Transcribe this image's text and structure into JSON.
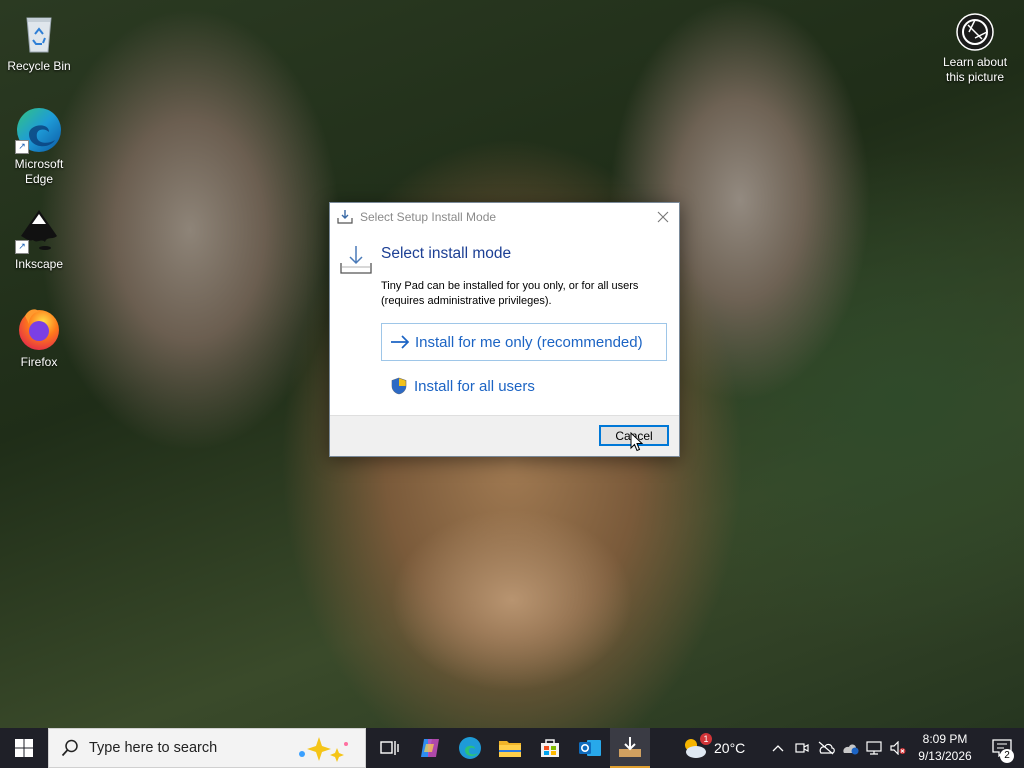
{
  "desktop": {
    "icons": [
      {
        "label": "Recycle Bin",
        "icon": "recycle-bin-icon"
      },
      {
        "label": "Microsoft Edge",
        "icon": "edge-icon"
      },
      {
        "label": "Inkscape",
        "icon": "inkscape-icon"
      },
      {
        "label": "Firefox",
        "icon": "firefox-icon"
      }
    ],
    "learn_label": "Learn about this picture"
  },
  "dialog": {
    "title": "Select Setup Install Mode",
    "heading": "Select install mode",
    "description": "Tiny Pad can be installed for you only, or for all users (requires administrative privileges).",
    "option_me": "Install for me only (recommended)",
    "option_all": "Install for all users",
    "cancel": "Cancel",
    "accent": "#1c64c4"
  },
  "taskbar": {
    "search_placeholder": "Type here to search",
    "weather_temp": "20°C",
    "weather_badge": "1",
    "time": "8:09 PM",
    "date": "9/13/2026",
    "notification_count": "2",
    "pinned": [
      "task-view-icon",
      "copilot-icon",
      "edge-icon",
      "file-explorer-icon",
      "store-icon",
      "outlook-icon",
      "setup-icon"
    ]
  }
}
